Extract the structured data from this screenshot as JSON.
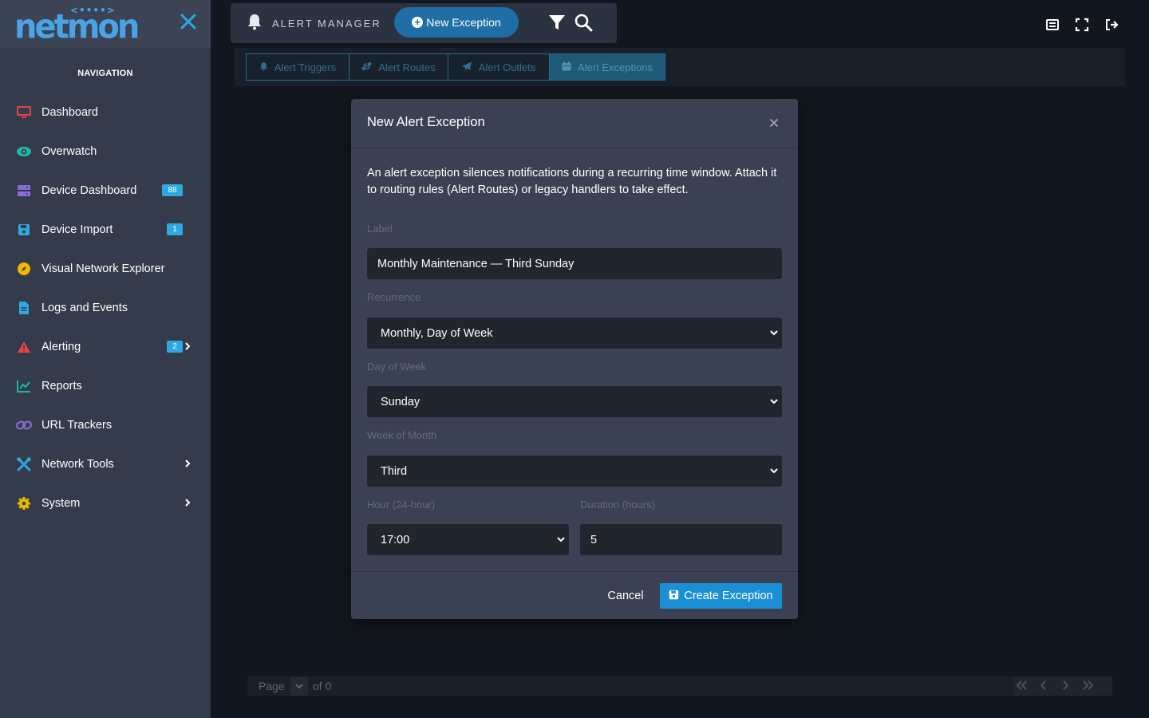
{
  "sidebar": {
    "logo_text": "netmon",
    "logo_dots": "<••••>",
    "nav_heading": "NAVIGATION",
    "items": [
      {
        "label": "Dashboard",
        "icon": "monitor-icon",
        "color": "#e64545"
      },
      {
        "label": "Overwatch",
        "icon": "eye-icon",
        "color": "#1fb8a8"
      },
      {
        "label": "Device Dashboard",
        "icon": "server-icon",
        "color": "#8a6ad8",
        "badge": "88"
      },
      {
        "label": "Device Import",
        "icon": "save-icon",
        "color": "#2ea8e0",
        "badge": "1"
      },
      {
        "label": "Visual Network Explorer",
        "icon": "compass-icon",
        "color": "#f0b800"
      },
      {
        "label": "Logs and Events",
        "icon": "file-icon",
        "color": "#2ea8e0"
      },
      {
        "label": "Alerting",
        "icon": "warning-icon",
        "color": "#e64545",
        "badge": "2",
        "has_submenu": true
      },
      {
        "label": "Reports",
        "icon": "chart-line-icon",
        "color": "#1fb8a8"
      },
      {
        "label": "URL Trackers",
        "icon": "link-icon",
        "color": "#8a6ad8"
      },
      {
        "label": "Network Tools",
        "icon": "tools-icon",
        "color": "#2ea8e0",
        "has_submenu": true
      },
      {
        "label": "System",
        "icon": "gear-icon",
        "color": "#f0b800",
        "has_submenu": true
      }
    ]
  },
  "topbar": {
    "title": "ALERT MANAGER",
    "new_button": "New Exception"
  },
  "tabs": [
    {
      "label": "Alert Triggers",
      "icon": "bell-icon"
    },
    {
      "label": "Alert Routes",
      "icon": "route-icon"
    },
    {
      "label": "Alert Outlets",
      "icon": "paper-plane-icon"
    },
    {
      "label": "Alert Exceptions",
      "icon": "calendar-icon",
      "active": true
    }
  ],
  "pager": {
    "page_label": "Page",
    "of_label": "of 0"
  },
  "modal": {
    "title": "New Alert Exception",
    "description": "An alert exception silences notifications during a recurring time window. Attach it to routing rules (Alert Routes) or legacy handlers to take effect.",
    "label_field": {
      "label": "Label",
      "value": "Monthly Maintenance — Third Sunday"
    },
    "recurrence": {
      "label": "Recurrence",
      "value": "Monthly, Day of Week"
    },
    "day_of_week": {
      "label": "Day of Week",
      "value": "Sunday"
    },
    "week_of_month": {
      "label": "Week of Month",
      "value": "Third"
    },
    "hour": {
      "label": "Hour (24-hour)",
      "value": "17:00"
    },
    "duration": {
      "label": "Duration (hours)",
      "value": "5"
    },
    "cancel_label": "Cancel",
    "create_label": "Create Exception"
  }
}
